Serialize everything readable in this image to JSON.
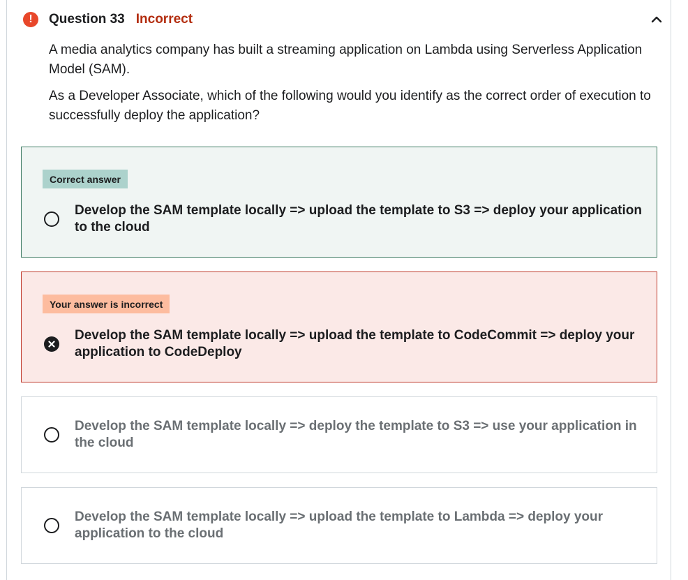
{
  "header": {
    "alert_icon": "exclamation-icon",
    "question_label": "Question 33",
    "status": "Incorrect",
    "collapse_icon": "chevron-up-icon"
  },
  "question": {
    "paragraph1": "A media analytics company has built a streaming application on Lambda using Serverless Application Model (SAM).",
    "paragraph2": "As a Developer Associate, which of the following would you identify as the correct order of execution to successfully deploy the application?"
  },
  "options": [
    {
      "badge": "Correct answer",
      "text": "Develop the SAM template locally => upload the template to S3 => deploy your application to the cloud"
    },
    {
      "badge": "Your answer is incorrect",
      "text": "Develop the SAM template locally => upload the template to CodeCommit => deploy your application to CodeDeploy"
    },
    {
      "text": "Develop the SAM template locally => deploy the template to S3 => use your application in the cloud"
    },
    {
      "text": "Develop the SAM template locally => upload the template to Lambda => deploy your application to the cloud"
    }
  ],
  "colors": {
    "correct_bg": "#f0f5f3",
    "correct_border": "#3e7b63",
    "incorrect_bg": "#fbe9e7",
    "incorrect_border": "#c0392b",
    "status_red": "#b32d0f"
  }
}
